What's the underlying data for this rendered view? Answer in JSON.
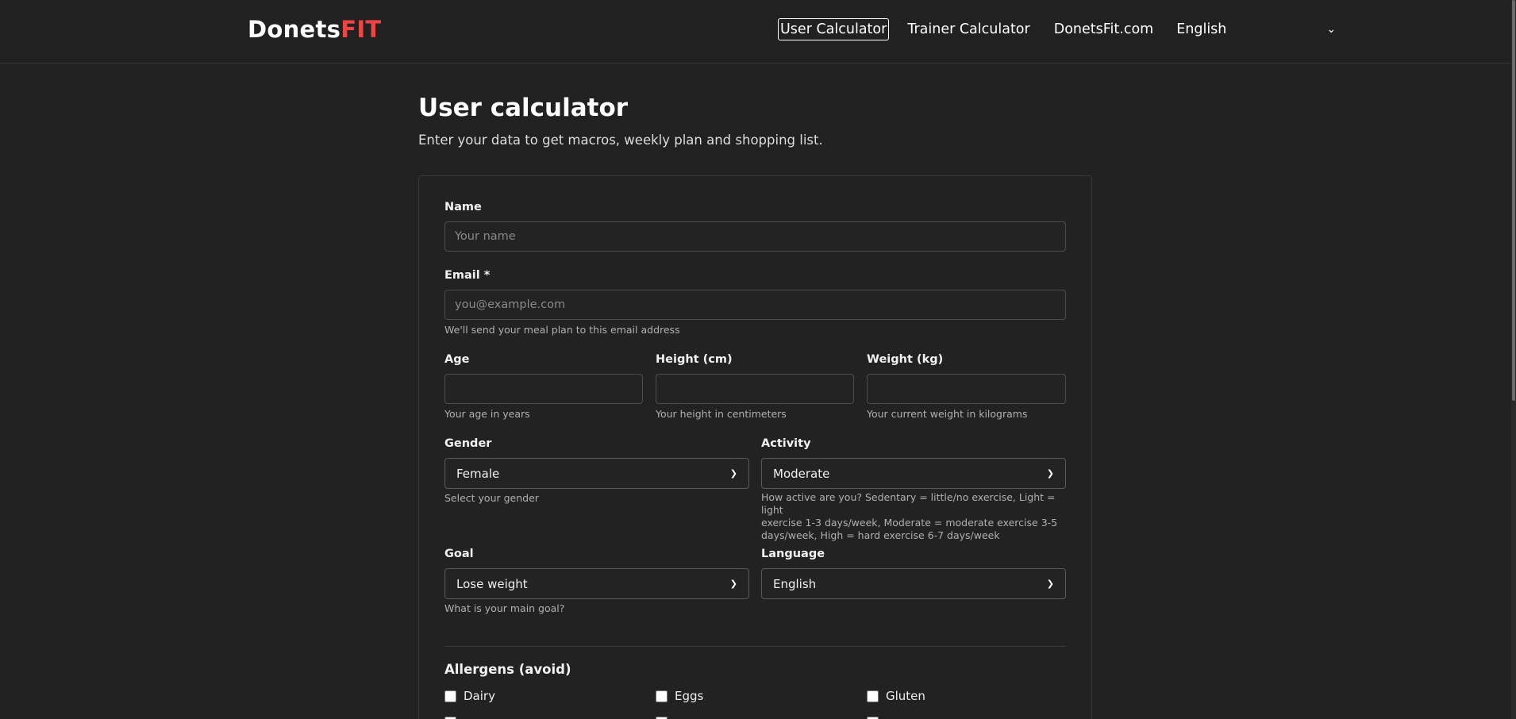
{
  "brand": {
    "main": "Donets",
    "accent": "FIT",
    "accent_color": "#ef4444"
  },
  "nav": {
    "items": [
      {
        "label": "User Calculator",
        "active": true
      },
      {
        "label": "Trainer Calculator"
      },
      {
        "label": "DonetsFit.com"
      }
    ],
    "language": {
      "value": "English",
      "icon": "chevron-down-icon"
    }
  },
  "page": {
    "title": "User calculator",
    "subtitle": "Enter your data to get macros, weekly plan and shopping list."
  },
  "form": {
    "name": {
      "label": "Name",
      "placeholder": "Your name"
    },
    "email": {
      "label": "Email *",
      "placeholder": "you@example.com",
      "help": "We'll send your meal plan to this email address"
    },
    "age": {
      "label": "Age",
      "help": "Your age in years"
    },
    "height": {
      "label": "Height (cm)",
      "help": "Your height in centimeters"
    },
    "weight": {
      "label": "Weight (kg)",
      "help": "Your current weight in kilograms"
    },
    "gender": {
      "label": "Gender",
      "value": "Female",
      "help": "Select your gender"
    },
    "activity": {
      "label": "Activity",
      "value": "Moderate",
      "help_lines": [
        "How active are you? Sedentary = little/no exercise, Light = light",
        "exercise 1-3 days/week, Moderate = moderate exercise 3-5",
        "days/week, High = hard exercise 6-7 days/week"
      ]
    },
    "goal": {
      "label": "Goal",
      "value": "Lose weight",
      "help": "What is your main goal?"
    },
    "language": {
      "label": "Language",
      "value": "English"
    },
    "allergens": {
      "title": "Allergens (avoid)",
      "items": [
        "Dairy",
        "Eggs",
        "Gluten"
      ]
    }
  }
}
